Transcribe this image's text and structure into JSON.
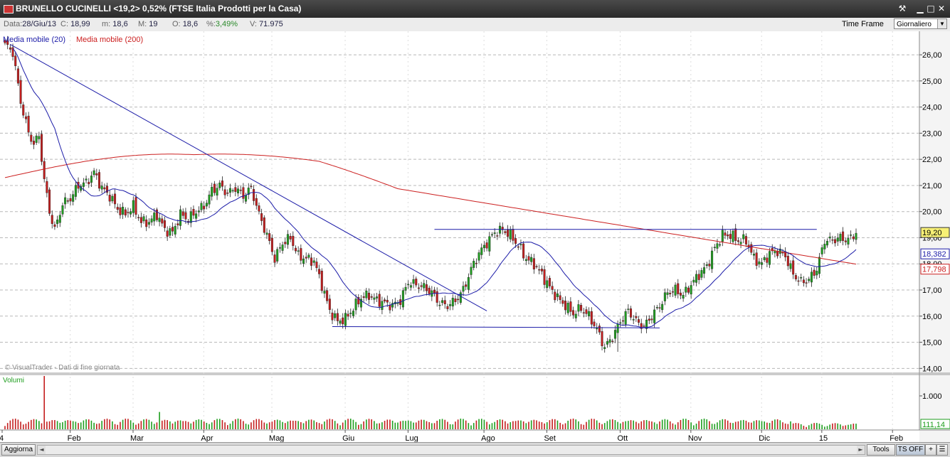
{
  "window": {
    "title": "BRUNELLO CUCINELLI <19,2> 0,52%  (FTSE Italia Prodotti per la Casa)",
    "icons": [
      "wrench-icon",
      "minimize-icon",
      "maximize-icon",
      "close-icon"
    ]
  },
  "infobar": {
    "data_label": "Data:",
    "data_value": "28/Giu/13",
    "c_label": "C:",
    "c_value": "18,99",
    "m_label": "m:",
    "m_value": "18,6",
    "M_label": "M:",
    "M_value": "19",
    "o_label": "O:",
    "o_value": "18,6",
    "pct_label": "%:",
    "pct_value": "3,49%",
    "v_label": "V:",
    "v_value": "71.975",
    "timeframe_label": "Time Frame",
    "timeframe_value": "Giornaliero"
  },
  "bottom": {
    "refresh_label": "Aggiorna",
    "tools_label": "Tools",
    "ts_label": "TS OFF",
    "plus_label": "+",
    "prev_label": "◄",
    "next_label": "►"
  },
  "chart_data": {
    "type": "candlestick",
    "watermark": "© VisualTrader - Dati di fine giornata",
    "legend": [
      "Media mobile (20)",
      "Media mobile (200)"
    ],
    "volume_label": "Volumi",
    "x_ticks": [
      "4",
      "Feb",
      "Mar",
      "Apr",
      "Mag",
      "Giu",
      "Lug",
      "Ago",
      "Set",
      "Ott",
      "Nov",
      "Dic",
      "15",
      "Feb"
    ],
    "y_ticks": [
      "26,00",
      "25,00",
      "24,00",
      "23,00",
      "22,00",
      "21,00",
      "20,00",
      "19,00",
      "18,00",
      "17,00",
      "16,00",
      "15,00",
      "14,00"
    ],
    "ylim": [
      13.9,
      26.9
    ],
    "volume_ticks": [
      "1.000",
      "111,14"
    ],
    "last_price_label": "19,20",
    "ma20_label": "18,382",
    "ma200_label": "17,798",
    "colors": {
      "up": "#1f9e1f",
      "down": "#c41e1e",
      "ma20": "#1c1ca8",
      "ma200": "#cc2020",
      "grid": "#b8b8b8",
      "trend": "#1c1ca8"
    },
    "price_anchors": [
      [
        0,
        26.4
      ],
      [
        3,
        26.1
      ],
      [
        6,
        24.2
      ],
      [
        9,
        23.0
      ],
      [
        11,
        22.6
      ],
      [
        13,
        22.9
      ],
      [
        15,
        21.2
      ],
      [
        17,
        20.0
      ],
      [
        19,
        19.3
      ],
      [
        22,
        20.3
      ],
      [
        25,
        20.5
      ],
      [
        28,
        21.0
      ],
      [
        31,
        21.1
      ],
      [
        34,
        21.5
      ],
      [
        37,
        20.9
      ],
      [
        40,
        20.6
      ],
      [
        43,
        20.1
      ],
      [
        46,
        19.9
      ],
      [
        49,
        20.2
      ],
      [
        52,
        19.6
      ],
      [
        55,
        19.6
      ],
      [
        58,
        19.9
      ],
      [
        61,
        19.3
      ],
      [
        64,
        19.2
      ],
      [
        67,
        19.9
      ],
      [
        70,
        19.7
      ],
      [
        73,
        20.0
      ],
      [
        76,
        20.2
      ],
      [
        79,
        20.8
      ],
      [
        82,
        21.0
      ],
      [
        85,
        20.7
      ],
      [
        88,
        20.9
      ],
      [
        91,
        20.6
      ],
      [
        94,
        20.9
      ],
      [
        97,
        19.9
      ],
      [
        100,
        19.1
      ],
      [
        103,
        18.2
      ],
      [
        106,
        18.8
      ],
      [
        109,
        19.0
      ],
      [
        112,
        18.3
      ],
      [
        115,
        18.2
      ],
      [
        118,
        18.1
      ],
      [
        121,
        17.2
      ],
      [
        124,
        16.2
      ],
      [
        127,
        15.8
      ],
      [
        130,
        15.9
      ],
      [
        133,
        16.3
      ],
      [
        136,
        16.7
      ],
      [
        139,
        16.8
      ],
      [
        142,
        16.6
      ],
      [
        145,
        16.5
      ],
      [
        148,
        16.4
      ],
      [
        151,
        16.6
      ],
      [
        154,
        17.3
      ],
      [
        157,
        17.2
      ],
      [
        160,
        17.1
      ],
      [
        163,
        16.9
      ],
      [
        166,
        16.5
      ],
      [
        169,
        16.4
      ],
      [
        172,
        16.6
      ],
      [
        175,
        17.0
      ],
      [
        178,
        17.8
      ],
      [
        181,
        18.4
      ],
      [
        184,
        18.8
      ],
      [
        187,
        19.2
      ],
      [
        190,
        19.3
      ],
      [
        193,
        19.1
      ],
      [
        196,
        18.7
      ],
      [
        199,
        18.2
      ],
      [
        202,
        18.0
      ],
      [
        205,
        17.6
      ],
      [
        208,
        17.1
      ],
      [
        211,
        16.7
      ],
      [
        214,
        16.4
      ],
      [
        217,
        16.1
      ],
      [
        220,
        16.3
      ],
      [
        223,
        16.0
      ],
      [
        226,
        15.5
      ],
      [
        229,
        14.8
      ],
      [
        232,
        15.2
      ],
      [
        235,
        15.8
      ],
      [
        238,
        16.2
      ],
      [
        241,
        15.8
      ],
      [
        244,
        15.6
      ],
      [
        247,
        16.0
      ],
      [
        250,
        16.4
      ],
      [
        253,
        16.9
      ],
      [
        256,
        17.0
      ],
      [
        259,
        16.8
      ],
      [
        262,
        17.2
      ],
      [
        265,
        17.6
      ],
      [
        268,
        17.9
      ],
      [
        271,
        18.6
      ],
      [
        274,
        19.1
      ],
      [
        277,
        19.1
      ],
      [
        280,
        18.9
      ],
      [
        283,
        18.9
      ],
      [
        286,
        18.2
      ],
      [
        289,
        18.0
      ],
      [
        292,
        18.4
      ],
      [
        295,
        18.5
      ],
      [
        298,
        18.3
      ],
      [
        301,
        17.6
      ],
      [
        304,
        17.3
      ],
      [
        307,
        17.4
      ],
      [
        310,
        17.8
      ],
      [
        313,
        18.9
      ],
      [
        316,
        18.9
      ],
      [
        319,
        19.0
      ],
      [
        322,
        18.9
      ],
      [
        325,
        19.2
      ]
    ],
    "bar_count": 326,
    "trendlines": [
      {
        "from": [
          2,
          26.4
        ],
        "to": [
          184,
          16.2
        ]
      },
      {
        "from": [
          125,
          15.6
        ],
        "to": [
          250,
          15.55
        ]
      },
      {
        "from": [
          164,
          19.32
        ],
        "to": [
          310,
          19.32
        ]
      }
    ]
  }
}
